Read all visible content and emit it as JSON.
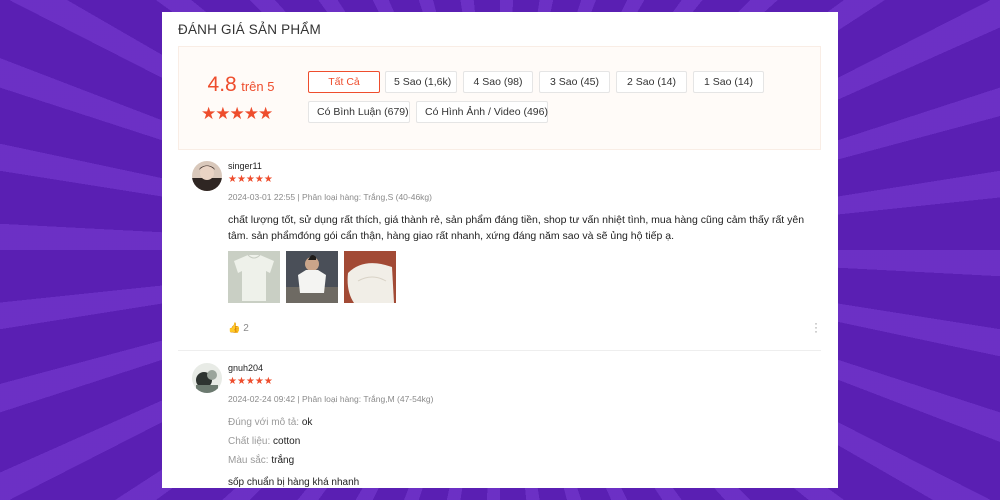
{
  "section_title": "ĐÁNH GIÁ SẢN PHẨM",
  "overview": {
    "score": "4.8",
    "score_suffix": "trên 5",
    "stars": "★★★★★",
    "filters": [
      "Tất Cả",
      "5 Sao (1,6k)",
      "4 Sao (98)",
      "3 Sao (45)",
      "2 Sao (14)",
      "1 Sao (14)",
      "Có Bình Luận (679)",
      "Có Hình Ảnh / Video (496)"
    ]
  },
  "reviews": [
    {
      "username": "singer11",
      "stars": "★★★★★",
      "meta": "2024-03-01 22:55 | Phân loại hàng: Trắng,S (40-46kg)",
      "comment": "chất lượng tốt, sử dụng rất thích, giá thành rẻ, sản phẩm đáng tiền, shop tư vấn nhiệt tình, mua hàng cũng cảm thấy rất yên tâm. sản phẩmđóng gói cẩn thận, hàng giao rất nhanh, xứng đáng năm sao và sẽ ủng hộ tiếp ạ.",
      "likes": "2",
      "photos": [
        "white-shirt-photo",
        "person-wearing-shirt-photo",
        "shirt-fabric-photo"
      ]
    },
    {
      "username": "gnuh204",
      "stars": "★★★★★",
      "meta": "2024-02-24 09:42 | Phân loại hàng: Trắng,M (47-54kg)",
      "attributes": [
        {
          "key": "Đúng với mô tả:",
          "value": "ok"
        },
        {
          "key": "Chất liệu:",
          "value": "cotton"
        },
        {
          "key": "Màu sắc:",
          "value": "trắng"
        }
      ],
      "comment": "sốp chuẩn bị hàng khá nhanh"
    }
  ],
  "colors": {
    "accent": "#ee4d2d",
    "background": "#5a1fb3",
    "panel": "#fffbf8"
  }
}
